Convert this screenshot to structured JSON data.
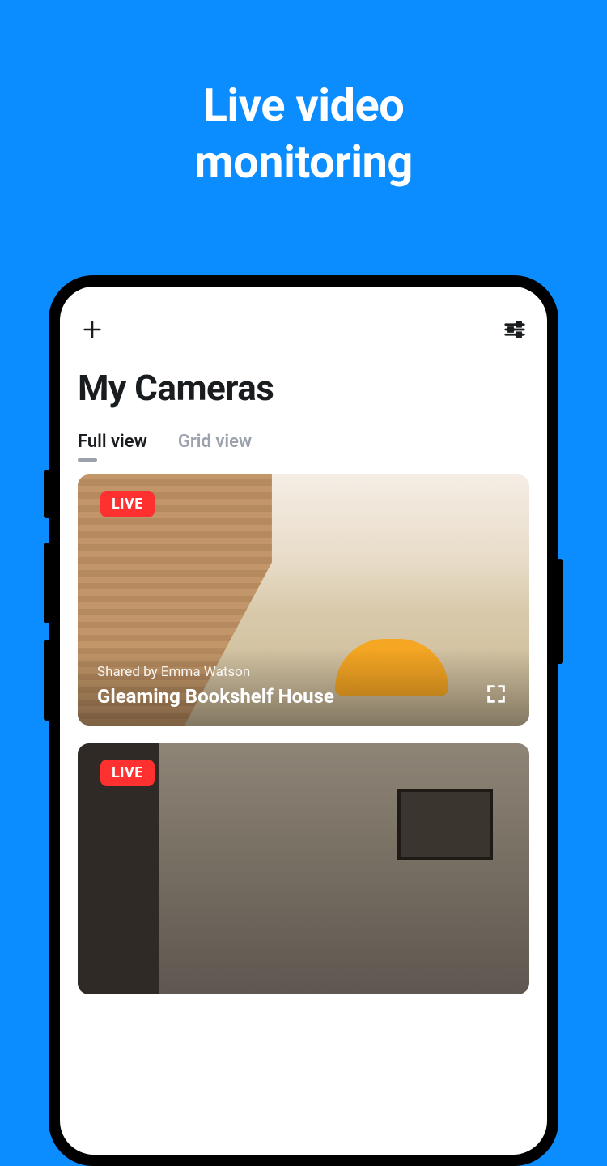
{
  "promo": {
    "title_line1": "Live video",
    "title_line2": "monitoring"
  },
  "header": {
    "page_title": "My Cameras"
  },
  "tabs": [
    {
      "label": "Full view",
      "active": true
    },
    {
      "label": "Grid view",
      "active": false
    }
  ],
  "cameras": [
    {
      "live_label": "LIVE",
      "shared_by": "Shared by Emma Watson",
      "title": "Gleaming Bookshelf House"
    },
    {
      "live_label": "LIVE",
      "shared_by": "",
      "title": ""
    }
  ]
}
